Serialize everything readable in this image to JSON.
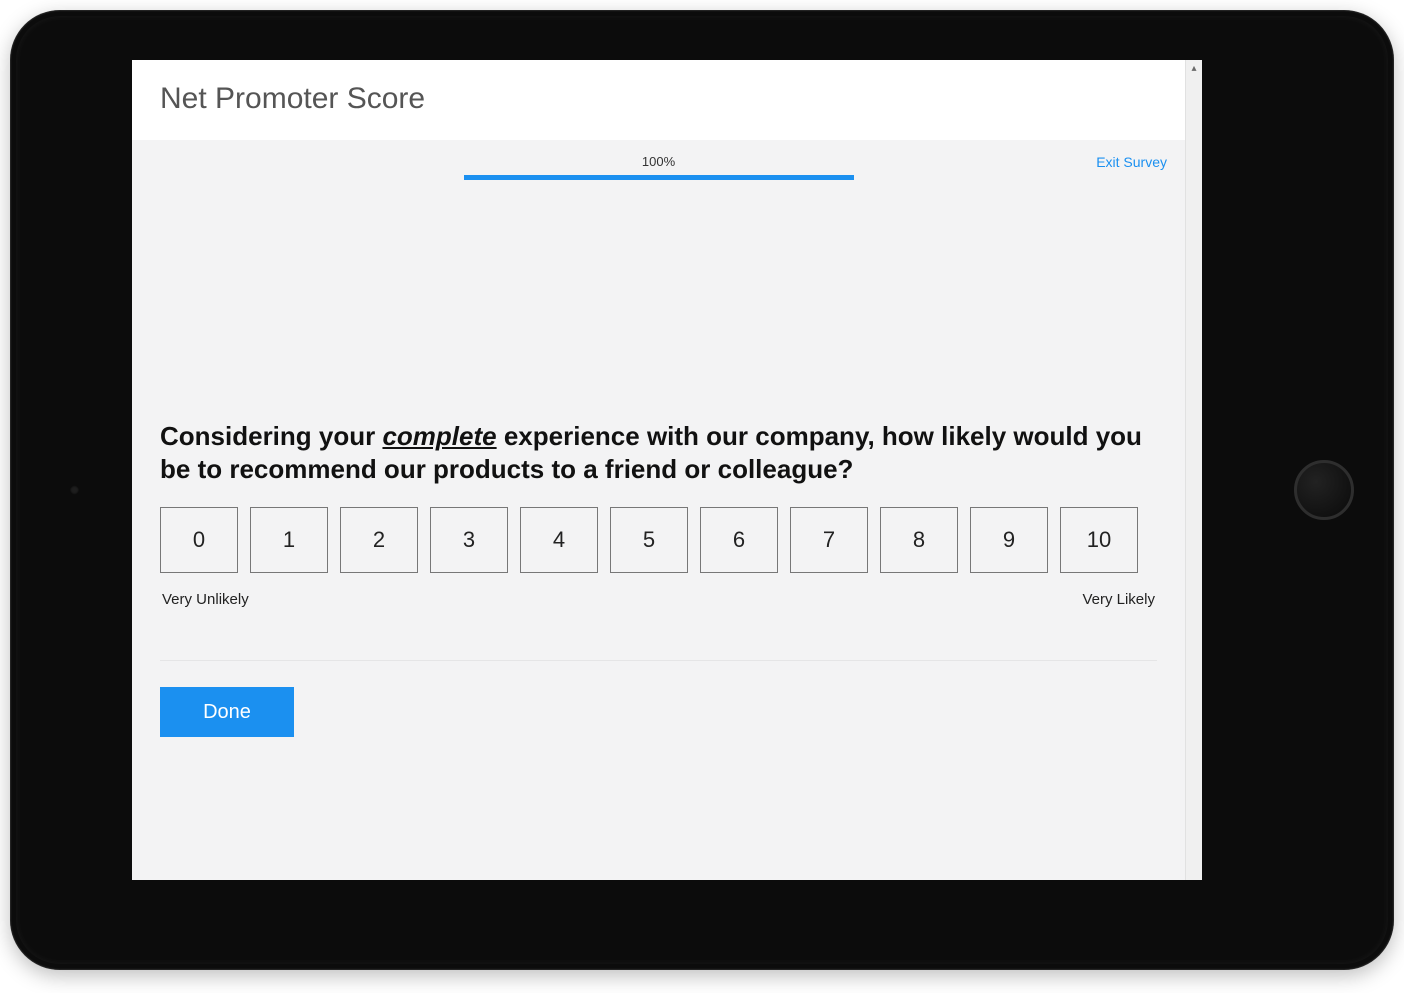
{
  "header": {
    "title": "Net Promoter Score"
  },
  "survey": {
    "exit_label": "Exit Survey",
    "progress": {
      "percent_label": "100%"
    },
    "question": {
      "part1": "Considering your ",
      "emph": "complete",
      "part2": " experience with our company, how likely would you be to recommend our products to a friend or colleague?"
    },
    "scale": {
      "options": [
        "0",
        "1",
        "2",
        "3",
        "4",
        "5",
        "6",
        "7",
        "8",
        "9",
        "10"
      ],
      "min_label": "Very Unlikely",
      "max_label": "Very Likely"
    },
    "done_label": "Done"
  }
}
